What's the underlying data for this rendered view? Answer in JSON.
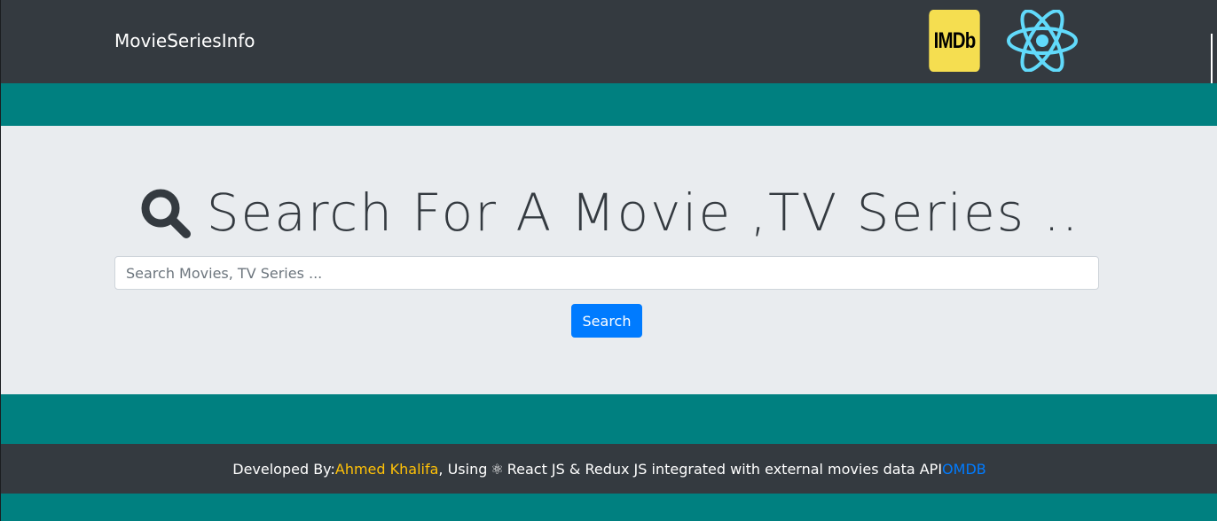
{
  "navbar": {
    "brand": "MovieSeriesInfo",
    "imdb_logo_text": "IMDb",
    "imdb_color": "#f5de50",
    "react_color": "#61dafb",
    "icons": [
      "imdb-logo",
      "react-atom-icon"
    ]
  },
  "hero": {
    "heading": "Search For A Movie ,TV Series ..",
    "heading_icon": "search-icon",
    "search_placeholder": "Search Movies, TV Series ...",
    "search_value": "",
    "search_button_label": "Search"
  },
  "footer": {
    "prefix": "Developed By:",
    "author": "Ahmed Khalifa",
    "middle_1": ", Using",
    "atom_glyph": "⚛",
    "middle_2": "React JS & Redux JS integrated with external movies data API",
    "api_link": "OMDB",
    "author_color": "#ffc107",
    "link_color": "#007bff"
  },
  "colors": {
    "background": "#008080",
    "navbar": "#343a40",
    "jumbotron": "#e9ecef",
    "primary": "#007bff"
  }
}
